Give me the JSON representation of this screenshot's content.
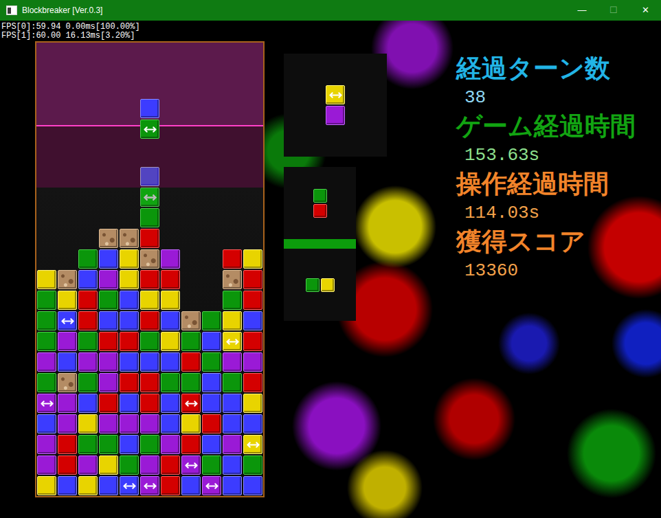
{
  "window": {
    "title": "Blockbreaker [Ver.0.3]",
    "controls": [
      {
        "label": "—",
        "disabled": false
      },
      {
        "label": "☐",
        "disabled": true
      },
      {
        "label": "✕",
        "disabled": false
      }
    ]
  },
  "fps": [
    "FPS[0]:59.94 0.00ms[100.00%]",
    "FPS[1]:60.00 16.13ms[3.20%]"
  ],
  "board": {
    "rows": [
      [
        "empty",
        "empty",
        "empty",
        "empty",
        "empty",
        "empty",
        "empty",
        "empty",
        "empty",
        "empty",
        "empty"
      ],
      [
        "empty",
        "empty",
        "empty",
        "empty",
        "empty",
        "empty",
        "empty",
        "empty",
        "empty",
        "empty",
        "empty"
      ],
      [
        "empty",
        "empty",
        "empty",
        "empty",
        "empty",
        "empty",
        "empty",
        "empty",
        "empty",
        "empty",
        "empty"
      ],
      [
        "empty",
        "empty",
        "empty",
        "empty",
        "empty",
        "falling-blue",
        "empty",
        "empty",
        "empty",
        "empty",
        "empty"
      ],
      [
        "empty",
        "empty",
        "empty",
        "empty",
        "empty",
        "falling-green-arrow",
        "empty",
        "empty",
        "empty",
        "empty",
        "empty"
      ],
      [
        "empty",
        "empty",
        "empty",
        "empty",
        "empty",
        "empty",
        "empty",
        "empty",
        "empty",
        "empty",
        "empty"
      ],
      [
        "empty",
        "empty",
        "empty",
        "empty",
        "empty",
        "ghost-blue",
        "empty",
        "empty",
        "empty",
        "empty",
        "empty"
      ],
      [
        "empty",
        "empty",
        "empty",
        "empty",
        "empty",
        "ghost-green-arrow",
        "empty",
        "empty",
        "empty",
        "empty",
        "empty"
      ],
      [
        "empty",
        "empty",
        "empty",
        "empty",
        "empty",
        "green",
        "empty",
        "empty",
        "empty",
        "empty",
        "empty"
      ],
      [
        "empty",
        "empty",
        "empty",
        "stone",
        "stone",
        "red",
        "empty",
        "empty",
        "empty",
        "empty",
        "empty"
      ],
      [
        "empty",
        "empty",
        "green",
        "blue",
        "yellow",
        "stone",
        "purple",
        "empty",
        "empty",
        "red",
        "yellow"
      ],
      [
        "yellow",
        "stone",
        "blue",
        "purple",
        "yellow",
        "red",
        "red",
        "empty",
        "empty",
        "stone",
        "red"
      ],
      [
        "green",
        "yellow",
        "red",
        "green",
        "blue",
        "yellow",
        "yellow",
        "empty",
        "empty",
        "green",
        "red"
      ],
      [
        "green",
        "blue-arrow",
        "red",
        "blue",
        "blue",
        "red",
        "blue",
        "stone",
        "green",
        "yellow",
        "blue"
      ],
      [
        "green",
        "purple",
        "green",
        "red",
        "red",
        "green",
        "yellow",
        "green",
        "blue",
        "yellow-arrow",
        "red"
      ],
      [
        "purple",
        "blue",
        "purple",
        "purple",
        "blue",
        "blue",
        "blue",
        "red",
        "green",
        "purple",
        "purple"
      ],
      [
        "green",
        "stone",
        "green",
        "purple",
        "red",
        "red",
        "green",
        "green",
        "blue",
        "green",
        "red"
      ],
      [
        "purple-arrow",
        "purple",
        "blue",
        "red",
        "blue",
        "red",
        "blue",
        "red-arrow",
        "blue",
        "blue",
        "yellow"
      ],
      [
        "blue",
        "purple",
        "yellow",
        "purple",
        "purple",
        "purple",
        "blue",
        "yellow",
        "red",
        "blue",
        "blue"
      ],
      [
        "purple",
        "red",
        "green",
        "green",
        "blue",
        "green",
        "purple",
        "red",
        "blue",
        "purple",
        "yellow-arrow"
      ],
      [
        "purple",
        "red",
        "purple",
        "yellow",
        "green",
        "purple",
        "red",
        "purple-arrow",
        "green",
        "blue",
        "green"
      ],
      [
        "yellow",
        "blue",
        "yellow",
        "blue",
        "blue-arrow",
        "purple-arrow",
        "red",
        "blue",
        "purple-arrow",
        "blue",
        "blue"
      ]
    ]
  },
  "next": [
    {
      "cells": [
        [
          "yellow-arrow"
        ],
        [
          "purple"
        ]
      ]
    },
    {
      "cells": [
        [
          "green"
        ],
        [
          "red"
        ]
      ]
    },
    {
      "cells": [
        [
          "green",
          "yellow"
        ]
      ]
    }
  ],
  "stats": [
    {
      "label": "経過ターン数",
      "value": "38",
      "color": "#22b4e6",
      "value_color": "#8fd8f4"
    },
    {
      "label": "ゲーム経過時間",
      "value": "153.63s",
      "color": "#12a412",
      "value_color": "#8ee08e"
    },
    {
      "label": "操作経過時間",
      "value": "114.03s",
      "color": "#f2842a",
      "value_color": "#f4a24a"
    },
    {
      "label": "獲得スコア",
      "value": "13360",
      "color": "#f2842a",
      "value_color": "#f4a24a"
    }
  ]
}
